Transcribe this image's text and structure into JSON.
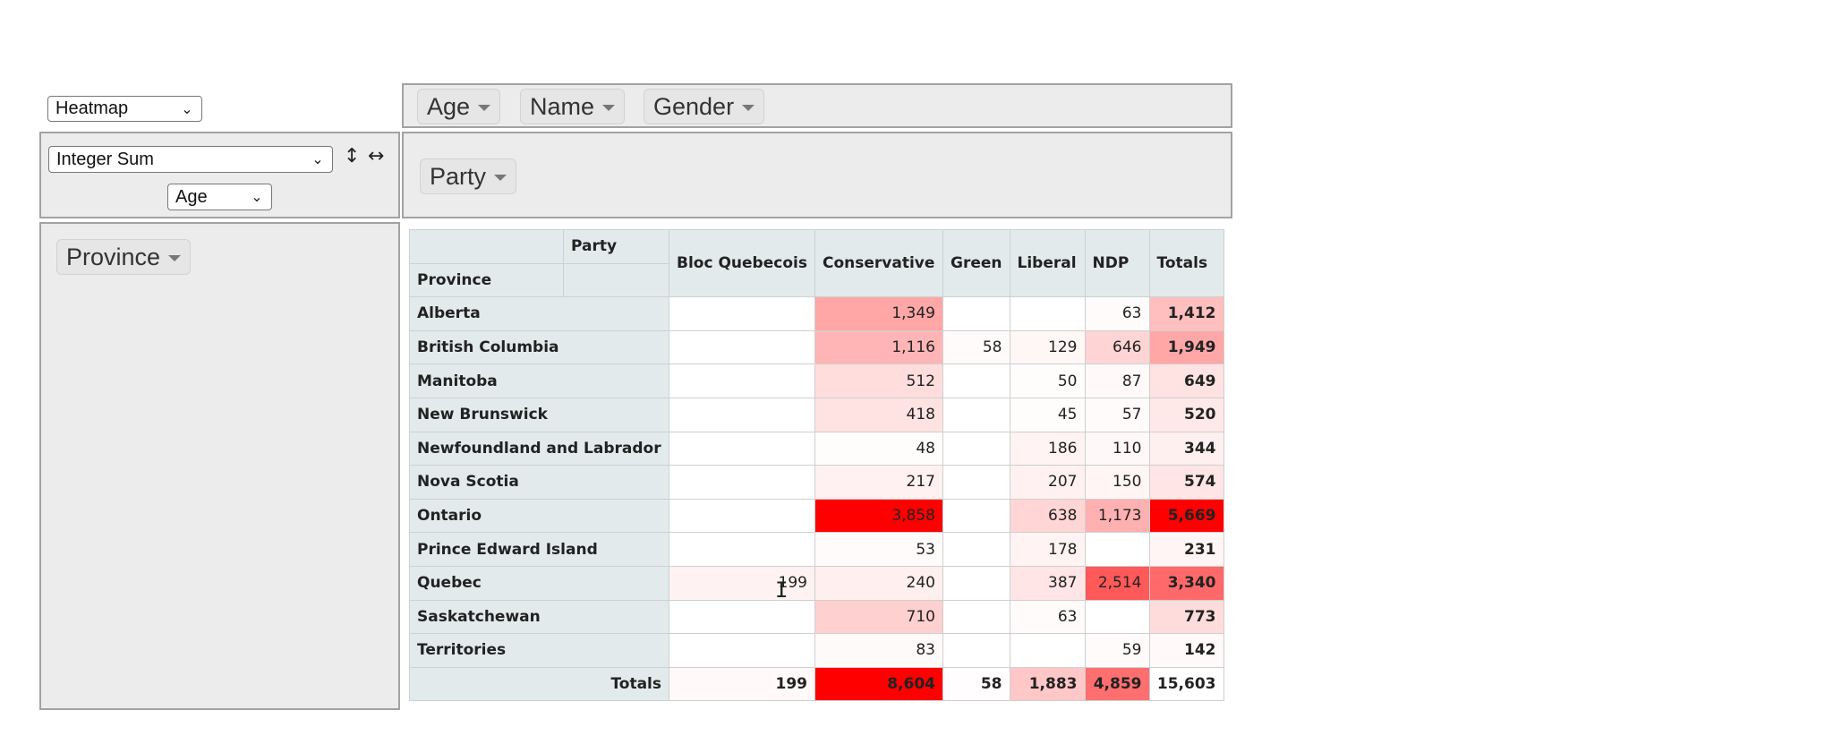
{
  "controls": {
    "renderer": "Heatmap",
    "aggregator": "Integer Sum",
    "attribute": "Age",
    "sort_rows_icon": "↕",
    "sort_cols_icon": "↔"
  },
  "unused_attrs": [
    "Age",
    "Name",
    "Gender"
  ],
  "col_attrs": [
    "Party"
  ],
  "row_attrs": [
    "Province"
  ],
  "table": {
    "col_attr_label": "Party",
    "row_attr_label": "Province",
    "columns": [
      "Bloc Quebecois",
      "Conservative",
      "Green",
      "Liberal",
      "NDP"
    ],
    "totals_label": "Totals",
    "rows": [
      {
        "label": "Alberta",
        "cells": [
          "",
          "1,349",
          "",
          "",
          "63"
        ],
        "total": "1,412"
      },
      {
        "label": "British Columbia",
        "cells": [
          "",
          "1,116",
          "58",
          "129",
          "646"
        ],
        "total": "1,949"
      },
      {
        "label": "Manitoba",
        "cells": [
          "",
          "512",
          "",
          "50",
          "87"
        ],
        "total": "649"
      },
      {
        "label": "New Brunswick",
        "cells": [
          "",
          "418",
          "",
          "45",
          "57"
        ],
        "total": "520"
      },
      {
        "label": "Newfoundland and Labrador",
        "cells": [
          "",
          "48",
          "",
          "186",
          "110"
        ],
        "total": "344"
      },
      {
        "label": "Nova Scotia",
        "cells": [
          "",
          "217",
          "",
          "207",
          "150"
        ],
        "total": "574"
      },
      {
        "label": "Ontario",
        "cells": [
          "",
          "3,858",
          "",
          "638",
          "1,173"
        ],
        "total": "5,669"
      },
      {
        "label": "Prince Edward Island",
        "cells": [
          "",
          "53",
          "",
          "178",
          ""
        ],
        "total": "231"
      },
      {
        "label": "Quebec",
        "cells": [
          "199",
          "240",
          "",
          "387",
          "2,514"
        ],
        "total": "3,340"
      },
      {
        "label": "Saskatchewan",
        "cells": [
          "",
          "710",
          "",
          "63",
          ""
        ],
        "total": "773"
      },
      {
        "label": "Territories",
        "cells": [
          "",
          "83",
          "",
          "",
          "59"
        ],
        "total": "142"
      }
    ],
    "col_totals": [
      "199",
      "8,604",
      "58",
      "1,883",
      "4,859"
    ],
    "grand_total": "15,603"
  }
}
